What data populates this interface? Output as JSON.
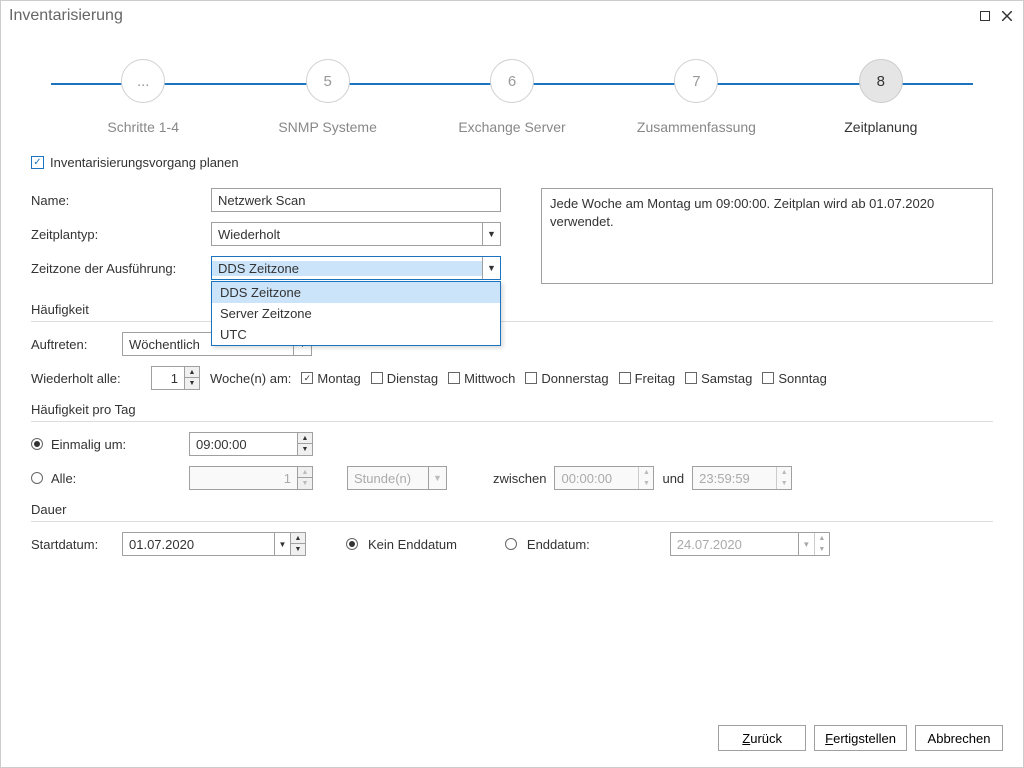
{
  "title": "Inventarisierung",
  "steps": [
    {
      "num": "...",
      "label": "Schritte 1-4"
    },
    {
      "num": "5",
      "label": "SNMP Systeme"
    },
    {
      "num": "6",
      "label": "Exchange Server"
    },
    {
      "num": "7",
      "label": "Zusammenfassung"
    },
    {
      "num": "8",
      "label": "Zeitplanung"
    }
  ],
  "planCheckbox": "Inventarisierungsvorgang planen",
  "labels": {
    "name": "Name:",
    "scheduleType": "Zeitplantyp:",
    "timezone": "Zeitzone der Ausführung:",
    "frequency": "Häufigkeit",
    "occur": "Auftreten:",
    "repeatEvery": "Wiederholt alle:",
    "weeksOn": "Woche(n) am:",
    "freqPerDay": "Häufigkeit pro Tag",
    "onceAt": "Einmalig um:",
    "every": "Alle:",
    "between": "zwischen",
    "and": "und",
    "duration": "Dauer",
    "startDate": "Startdatum:",
    "noEnd": "Kein Enddatum",
    "endDate": "Enddatum:"
  },
  "values": {
    "name": "Netzwerk Scan",
    "scheduleType": "Wiederholt",
    "timezone": "DDS Zeitzone",
    "timezoneOptions": [
      "DDS Zeitzone",
      "Server Zeitzone",
      "UTC"
    ],
    "occur": "Wöchentlich",
    "repeatCount": "1",
    "onceTime": "09:00:00",
    "everyCount": "1",
    "everyUnit": "Stunde(n)",
    "betweenStart": "00:00:00",
    "betweenEnd": "23:59:59",
    "startDate": "01.07.2020",
    "endDate": "24.07.2020"
  },
  "days": {
    "mon": "Montag",
    "tue": "Dienstag",
    "wed": "Mittwoch",
    "thu": "Donnerstag",
    "fri": "Freitag",
    "sat": "Samstag",
    "sun": "Sonntag"
  },
  "summary": "Jede Woche am Montag um 09:00:00. Zeitplan wird ab 01.07.2020 verwendet.",
  "buttons": {
    "back": "Zurück",
    "finish": "Fertigstellen",
    "cancel": "Abbrechen"
  }
}
